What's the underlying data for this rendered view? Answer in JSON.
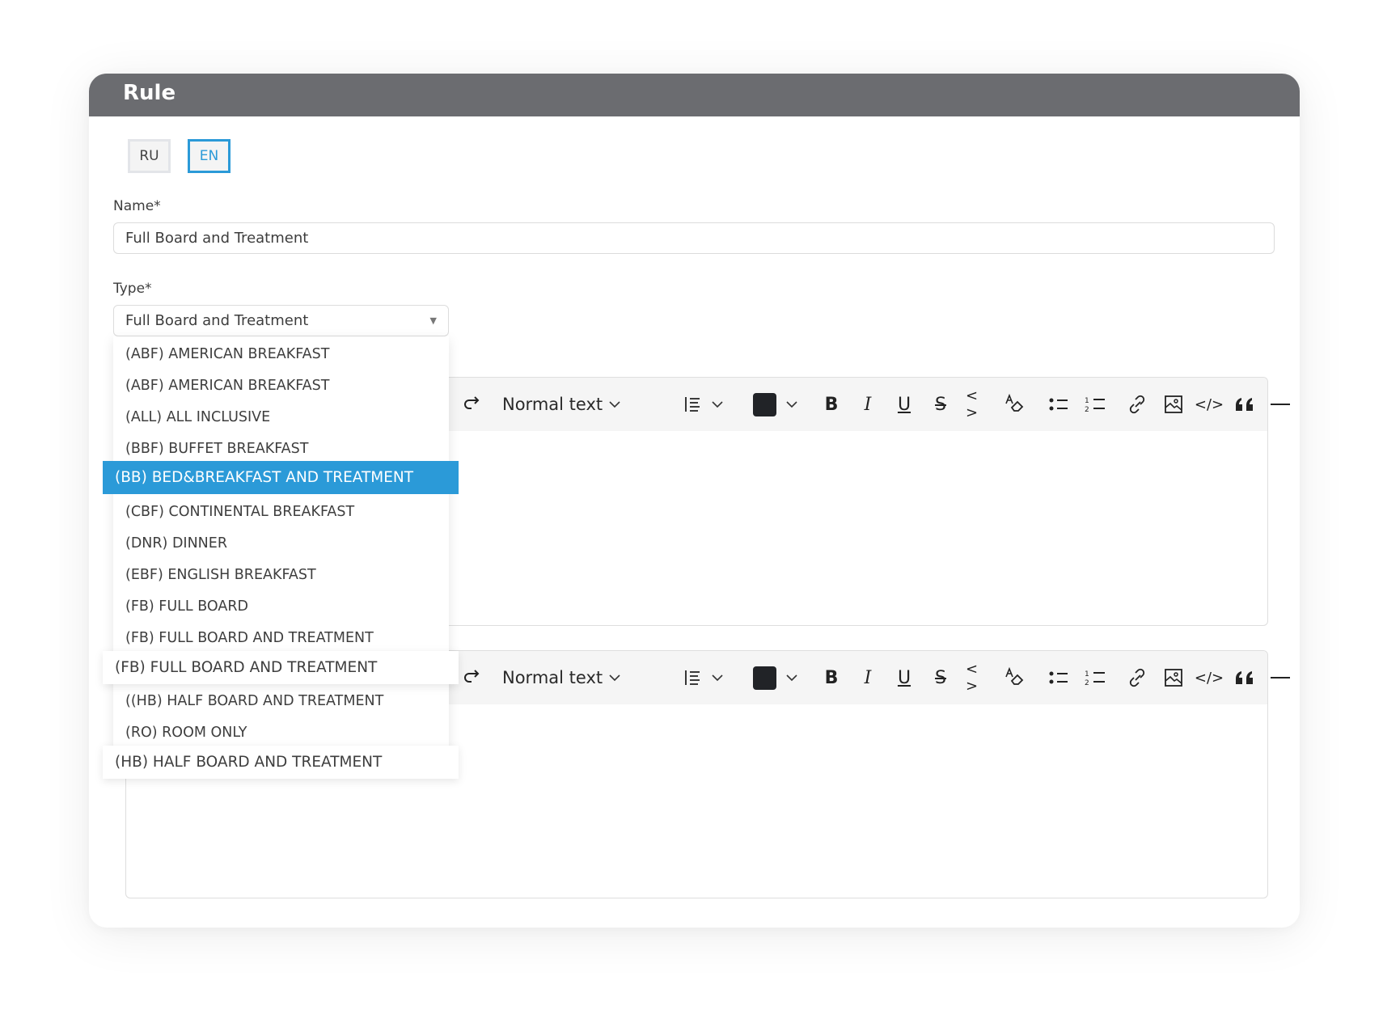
{
  "card": {
    "title": "Rule"
  },
  "languages": [
    {
      "label": "RU",
      "active": false
    },
    {
      "label": "EN",
      "active": true
    }
  ],
  "name_field": {
    "label": "Name*",
    "value": "Full Board and Treatment"
  },
  "type_field": {
    "label": "Type*",
    "value": "Full Board and Treatment",
    "options": [
      "(ABF) AMERICAN BREAKFAST",
      "(ABF) AMERICAN BREAKFAST",
      "(ALL) ALL INCLUSIVE",
      "(BBF) BUFFET BREAKFAST",
      "(BB) BED&BREAKFAST AND TREATMENT",
      "(CBF) CONTINENTAL BREAKFAST",
      "(DNR) DINNER",
      "(EBF) ENGLISH BREAKFAST",
      "(FB) FULL BOARD",
      "(FB) FULL BOARD AND TREATMENT",
      "(FB) FULL BOARD AND TREATMENT",
      "((HB) HALF BOARD AND TREATMENT",
      "(RO) ROOM ONLY",
      "(HB) HALF BOARD AND TREATMENT"
    ],
    "highlighted_option": "(BB) BED&BREAKFAST AND TREATMENT"
  },
  "editor_toolbar": {
    "block_style": "Normal text",
    "text_color": "#212327",
    "icons": [
      "redo-icon",
      "align-icon",
      "bold-icon",
      "italic-icon",
      "underline-icon",
      "strikethrough-icon",
      "inline-code-icon",
      "clear-format-icon",
      "bullet-list-icon",
      "numbered-list-icon",
      "link-icon",
      "image-icon",
      "code-block-icon",
      "quote-icon",
      "horizontal-rule-icon"
    ]
  },
  "colors": {
    "accent": "#2b9ad8",
    "header": "#6b6c70"
  }
}
